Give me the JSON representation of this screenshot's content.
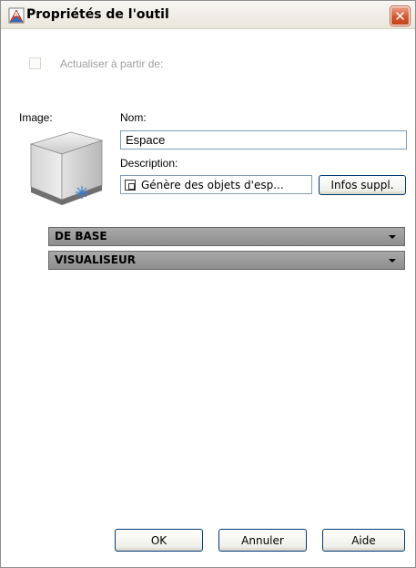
{
  "window": {
    "title": "Propriétés de l'outil",
    "close_symbol": "✕"
  },
  "update": {
    "label": "Actualiser à partir de:",
    "checked": false,
    "enabled": false
  },
  "image": {
    "label": "Image:",
    "preview_icon": "space-cube-icon"
  },
  "name": {
    "label": "Nom:",
    "value": "Espace"
  },
  "description": {
    "label": "Description:",
    "value": "Génère des objets d'esp...",
    "info_button": "Infos suppl."
  },
  "sections": [
    {
      "label": "DE BASE",
      "expanded": false
    },
    {
      "label": "VISUALISEUR",
      "expanded": false
    }
  ],
  "buttons": {
    "ok": "OK",
    "cancel": "Annuler",
    "help": "Aide"
  },
  "colors": {
    "accent_close": "#d5582f",
    "section_header": "#9a9a9a",
    "input_border": "#7f9db9",
    "disabled_text": "#a0a0a0"
  }
}
